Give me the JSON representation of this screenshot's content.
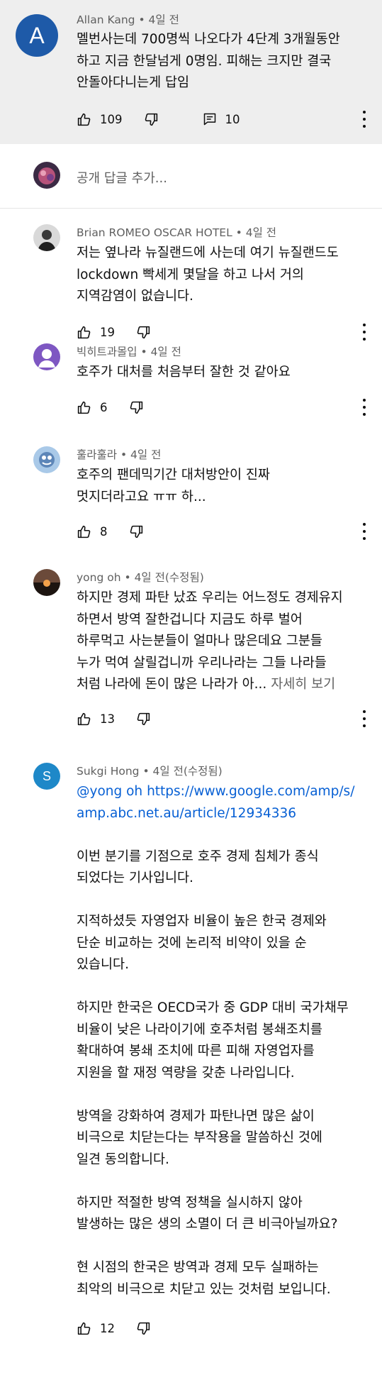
{
  "top_comment": {
    "avatar_letter": "A",
    "avatar_color": "#1e5aa8",
    "author": "Allan Kang",
    "time": "4일 전",
    "lines": [
      "멜번사는데 700명씩 나오다가 4단계 3개월동안",
      "하고 지금 한달넘게 0명임. 피해는 크지만 결국",
      "안돌아다니는게 답임"
    ],
    "likes": "109",
    "replies": "10"
  },
  "reply_box": {
    "placeholder": "공개 답글 추가..."
  },
  "replies": [
    {
      "author": "Brian ROMEO OSCAR HOTEL",
      "time": "4일 전",
      "lines": [
        "저는 옆나라 뉴질랜드에 사는데 여기 뉴질랜드도",
        "lockdown 빡세게 몇달을 하고 나서 거의",
        "지역감염이 없습니다."
      ],
      "likes": "19"
    },
    {
      "author": "빅히트과몰입",
      "time": "4일 전",
      "lines": [
        "호주가 대처를 처음부터 잘한 것 같아요"
      ],
      "likes": "6",
      "avatar_color": "#7e57c2"
    },
    {
      "author": "훌라훌라",
      "time": "4일 전",
      "lines": [
        "호주의 팬데믹기간 대처방안이 진짜",
        "멋지더라고요 ㅠㅠ 하..."
      ],
      "likes": "8"
    },
    {
      "author": "yong oh",
      "time": "4일 전(수정됨)",
      "lines": [
        "하지만 경제 파탄 났죠 우리는 어느정도 경제유지",
        "하면서 방역 잘한겁니다 지금도 하루 벌어",
        "하루먹고 사는분들이 얼마나 많은데요 그분들",
        "누가 먹여 살릴겁니까 우리나라는 그들 나라들"
      ],
      "last_line": "처럼 나라에 돈이 많은 나라가 아...",
      "read_more": "자세히 보기",
      "likes": "13"
    },
    {
      "author": "Sukgi Hong",
      "time": "4일 전(수정됨)",
      "avatar_letter": "S",
      "avatar_color": "#1e88c8",
      "mention": "@yong oh",
      "url_part1": "https://www.google.com/amp/s/",
      "url_part2": "amp.abc.net.au/article/12934336",
      "paragraphs": [
        [
          "이번 분기를 기점으로 호주 경제 침체가 종식",
          "되었다는 기사입니다."
        ],
        [
          "지적하셨듯 자영업자 비율이 높은 한국 경제와",
          "단순 비교하는 것에 논리적 비약이 있을 순",
          "있습니다."
        ],
        [
          "하지만 한국은 OECD국가 중 GDP 대비 국가채무",
          "비율이 낮은 나라이기에 호주처럼 봉쇄조치를",
          "확대하여 봉쇄 조치에 따른 피해 자영업자를",
          "지원을 할 재정 역량을 갖춘 나라입니다."
        ],
        [
          "방역을 강화하여 경제가 파탄나면 많은 삶이",
          "비극으로 치닫는다는 부작용을 말씀하신 것에",
          "일견 동의합니다."
        ],
        [
          "하지만 적절한 방역 정책을 실시하지 않아",
          "발생하는 많은 생의 소멸이 더 큰 비극아닐까요?"
        ],
        [
          "현 시점의 한국은 방역과 경제 모두 실패하는",
          "최악의 비극으로 치닫고 있는 것처럼 보입니다."
        ]
      ],
      "likes": "12"
    }
  ]
}
